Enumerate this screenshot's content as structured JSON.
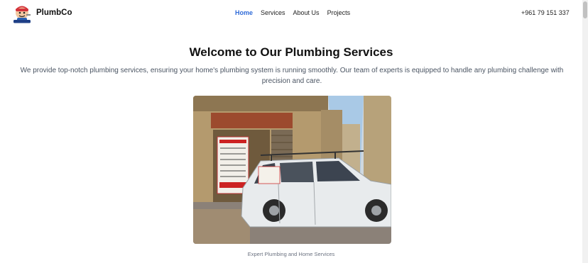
{
  "header": {
    "brand": "PlumbCo",
    "logo_icon": "plumber-mascot-icon",
    "nav": [
      {
        "label": "Home",
        "active": true
      },
      {
        "label": "Services",
        "active": false
      },
      {
        "label": "About Us",
        "active": false
      },
      {
        "label": "Projects",
        "active": false
      }
    ],
    "phone": "+961 79 151 337"
  },
  "hero": {
    "title": "Welcome to Our Plumbing Services",
    "description": "We provide top-notch plumbing services, ensuring your home's plumbing system is running smoothly. Our team of experts is equipped to handle any plumbing challenge with precision and care.",
    "image_caption": "Expert Plumbing and Home Services"
  },
  "colors": {
    "accent": "#2f6bd8",
    "text": "#111111",
    "muted": "#4b5563"
  }
}
